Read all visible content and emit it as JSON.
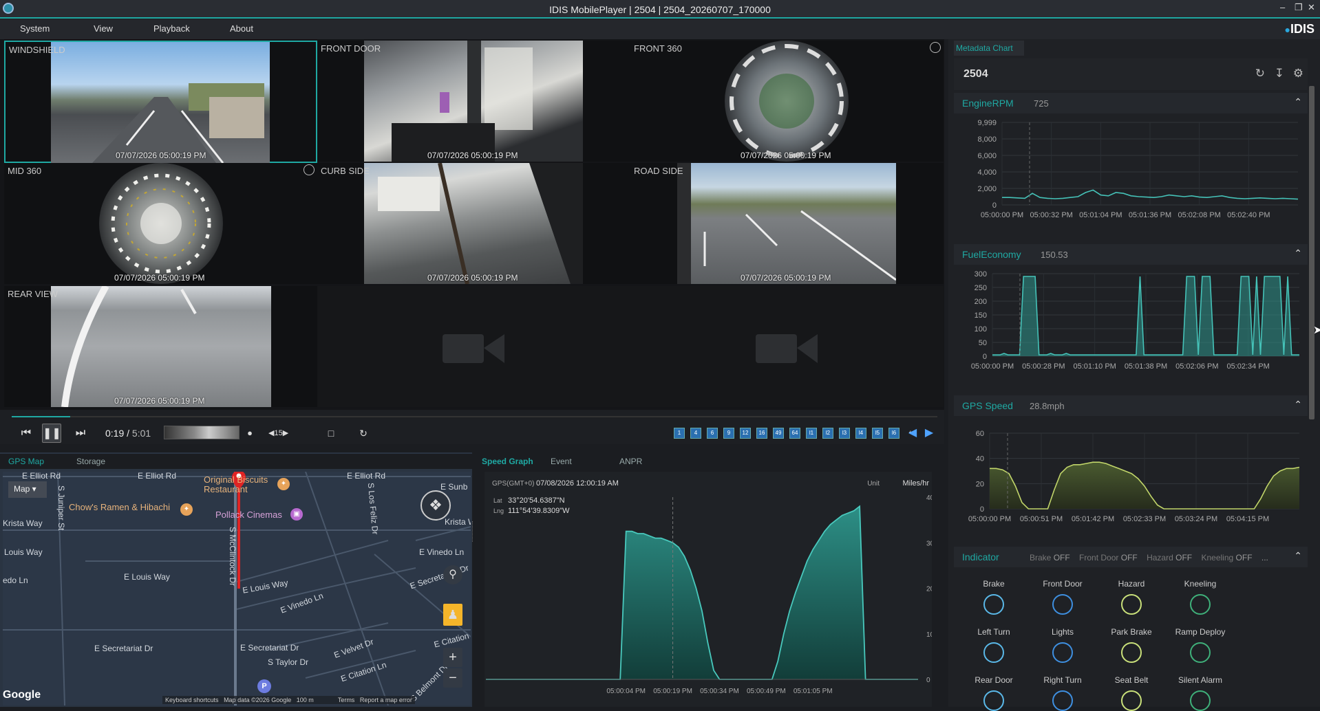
{
  "window": {
    "title": "IDIS MobilePlayer | 2504 | 2504_20260707_170000"
  },
  "menu": [
    "System",
    "View",
    "Playback",
    "About"
  ],
  "brand": "IDIS",
  "cameras": [
    {
      "label": "WINDSHIELD",
      "timestamp": "07/07/2026 05:00:19 PM"
    },
    {
      "label": "FRONT DOOR",
      "timestamp": "07/07/2026 05:00:19 PM"
    },
    {
      "label": "FRONT 360",
      "timestamp": "07/07/2026 05:00:19 PM"
    },
    {
      "label": "MID 360",
      "timestamp": "07/07/2026 05:00:19 PM"
    },
    {
      "label": "CURB SIDE",
      "timestamp": "07/07/2026 05:00:19 PM"
    },
    {
      "label": "ROAD SIDE",
      "timestamp": "07/07/2026 05:00:19 PM"
    },
    {
      "label": "REAR VIEW",
      "timestamp": "07/07/2026 05:00:19 PM"
    }
  ],
  "playback": {
    "current": "0:19",
    "separator": "/",
    "total": "5:01",
    "progress": 0.063,
    "skip": "15"
  },
  "layout_buttons": [
    "1",
    "4",
    "6",
    "9",
    "12",
    "16",
    "49",
    "64",
    "l1",
    "l2",
    "l3",
    "l4",
    "l5",
    "l6",
    "+"
  ],
  "bottom_left_tabs": {
    "gps_map": "GPS Map",
    "storage": "Storage"
  },
  "map": {
    "type_button": "Map",
    "labels": [
      "E Elliot Rd",
      "E Elliot Rd",
      "E Sunb",
      "E Elliot Rd",
      "S Juniper St",
      "Krista Way",
      "Krista Way",
      "Louis Way",
      "E Louis Way",
      "E Louis Way",
      "edo Ln",
      "S McClintock Dr",
      "S Los Feliz Dr",
      "E Vinedo Ln",
      "E Vinedo Ln",
      "E Secretariat Dr",
      "E Secretariat Dr",
      "E Secretarian Dr",
      "E Velvet Dr",
      "S Taylor Dr",
      "E Citation Ln",
      "E Citation",
      "S Belmont Dr"
    ],
    "poi": {
      "biscuits": "Original Biscuits Restaurant",
      "ramen": "Chow's Ramen & Hibachi",
      "cinema": "Pollack Cinemas"
    },
    "attribution": {
      "google": "Google",
      "shortcuts": "Keyboard shortcuts",
      "data": "Map data ©2026 Google",
      "scale": "100 m",
      "terms": "Terms",
      "report": "Report a map error"
    }
  },
  "speed_tabs": {
    "speed_graph": "Speed Graph",
    "event": "Event",
    "anpr": "ANPR"
  },
  "speed_graph": {
    "gps_label": "GPS(GMT+0)",
    "gps_datetime": "07/08/2026 12:00:19 AM",
    "unit_label": "Unit",
    "unit_value": "Miles/hr",
    "lat_label": "Lat",
    "lat": "33°20'54.6387\"N",
    "lng_label": "Lng",
    "lng": "111°54'39.8309\"W"
  },
  "metadata": {
    "tab": "Metadata Chart",
    "vehicle": "2504",
    "engine_rpm": {
      "name": "EngineRPM",
      "value": "725"
    },
    "fuel_economy": {
      "name": "FuelEconomy",
      "value": "150.53"
    },
    "gps_speed": {
      "name": "GPS Speed",
      "value": "28.8mph"
    },
    "indicator": {
      "name": "Indicator",
      "summary": [
        {
          "label": "Brake",
          "state": "OFF"
        },
        {
          "label": "Front Door",
          "state": "OFF"
        },
        {
          "label": "Hazard",
          "state": "OFF"
        },
        {
          "label": "Kneeling",
          "state": "OFF"
        }
      ],
      "more": "...",
      "items": [
        {
          "label": "Brake",
          "color": "#5ab8e8"
        },
        {
          "label": "Front Door",
          "color": "#3e8fe0"
        },
        {
          "label": "Hazard",
          "color": "#c9e07a"
        },
        {
          "label": "Kneeling",
          "color": "#3fb07a"
        },
        {
          "label": "Left Turn",
          "color": "#5ab8e8"
        },
        {
          "label": "Lights",
          "color": "#3e8fe0"
        },
        {
          "label": "Park Brake",
          "color": "#c9e07a"
        },
        {
          "label": "Ramp Deploy",
          "color": "#3fb07a"
        },
        {
          "label": "Rear Door",
          "color": "#5ab8e8"
        },
        {
          "label": "Right Turn",
          "color": "#3e8fe0"
        },
        {
          "label": "Seat Belt",
          "color": "#c9e07a"
        },
        {
          "label": "Silent Alarm",
          "color": "#3fb07a"
        }
      ]
    }
  },
  "chart_data": [
    {
      "type": "area",
      "x_ticks": [
        "05:00:04 PM",
        "05:00:19 PM",
        "05:00:34 PM",
        "05:00:49 PM",
        "05:01:05 PM"
      ],
      "ylim": [
        0,
        40
      ],
      "y_ticks": [
        0,
        10,
        20,
        30,
        40
      ],
      "x": [
        0,
        1,
        2,
        3,
        4,
        5,
        6,
        7,
        8,
        9,
        10,
        11,
        12,
        13,
        14,
        15,
        16,
        17,
        18,
        19,
        20,
        21,
        22,
        23,
        24,
        25,
        26,
        27,
        28,
        29,
        30,
        31,
        32,
        33,
        34,
        35,
        36,
        37,
        38,
        39,
        40,
        41,
        42,
        43,
        44,
        45,
        46,
        47,
        48,
        49,
        50,
        51,
        52,
        53,
        54,
        55,
        56,
        57,
        58,
        59,
        60,
        61,
        62,
        63,
        64,
        65,
        66,
        67,
        68,
        69,
        70,
        71,
        72,
        73,
        74
      ],
      "values": [
        0,
        0,
        0,
        0,
        0,
        0,
        0,
        0,
        0,
        0,
        0,
        0,
        0,
        0,
        0,
        0,
        0,
        0,
        0,
        0,
        0,
        0,
        0,
        0,
        32.5,
        32.5,
        32,
        32,
        31.5,
        31,
        31,
        30.5,
        30,
        29,
        27,
        24,
        20,
        15,
        8,
        2,
        0,
        0,
        0,
        0,
        0,
        0,
        0,
        0,
        0,
        0,
        4,
        10,
        15,
        19,
        22.5,
        26,
        28.5,
        30.5,
        32.5,
        34,
        35,
        36,
        36.5,
        37,
        38,
        0,
        0,
        0,
        0,
        0,
        0,
        0,
        0,
        0,
        0
      ],
      "cursor_x": "05:00:19 PM"
    },
    {
      "type": "line",
      "title": "EngineRPM",
      "x_ticks": [
        "05:00:00 PM",
        "05:00:32 PM",
        "05:01:04 PM",
        "05:01:36 PM",
        "05:02:08 PM",
        "05:02:40 PM"
      ],
      "y_ticks": [
        "0",
        "2,000",
        "4,000",
        "6,000",
        "8,000",
        "9,999"
      ],
      "ylim": [
        0,
        9999
      ],
      "values": [
        900,
        900,
        850,
        800,
        1400,
        900,
        800,
        750,
        800,
        900,
        1000,
        1500,
        1800,
        1200,
        1100,
        1500,
        1400,
        1100,
        1000,
        950,
        900,
        1000,
        1200,
        1100,
        1000,
        1100,
        950,
        900,
        1000,
        1100,
        900,
        800,
        750,
        800,
        850,
        800,
        750,
        800,
        750,
        700
      ]
    },
    {
      "type": "line",
      "title": "FuelEconomy",
      "x_ticks": [
        "05:00:00 PM",
        "05:00:28 PM",
        "05:01:10 PM",
        "05:01:38 PM",
        "05:02:06 PM",
        "05:02:34 PM"
      ],
      "y_ticks": [
        0,
        50,
        100,
        150,
        200,
        250,
        300
      ],
      "ylim": [
        0,
        300
      ],
      "values": [
        5,
        5,
        5,
        10,
        5,
        5,
        5,
        5,
        290,
        290,
        290,
        290,
        5,
        5,
        5,
        10,
        5,
        5,
        5,
        10,
        5,
        5,
        5,
        5,
        5,
        5,
        5,
        5,
        5,
        5,
        5,
        5,
        5,
        5,
        5,
        5,
        5,
        5,
        290,
        5,
        5,
        5,
        5,
        5,
        5,
        5,
        5,
        5,
        5,
        5,
        290,
        290,
        290,
        5,
        290,
        290,
        290,
        5,
        5,
        5,
        5,
        5,
        5,
        5,
        290,
        290,
        290,
        5,
        290,
        5,
        290,
        290,
        290,
        290,
        290,
        5,
        290,
        5,
        5,
        5
      ]
    },
    {
      "type": "area",
      "title": "GPS Speed",
      "x_ticks": [
        "05:00:00 PM",
        "05:00:51 PM",
        "05:01:42 PM",
        "05:02:33 PM",
        "05:03:24 PM",
        "05:04:15 PM"
      ],
      "y_ticks": [
        0,
        20,
        40,
        60
      ],
      "ylim": [
        0,
        60
      ],
      "values": [
        32,
        32,
        31,
        28,
        18,
        5,
        0,
        0,
        0,
        0,
        15,
        28,
        33,
        35,
        35,
        36,
        37,
        37,
        36,
        34,
        32,
        30,
        28,
        24,
        18,
        10,
        3,
        0,
        0,
        0,
        0,
        0,
        0,
        0,
        0,
        0,
        0,
        0,
        0,
        0,
        0,
        0,
        8,
        18,
        26,
        30,
        32,
        32,
        33
      ]
    }
  ]
}
